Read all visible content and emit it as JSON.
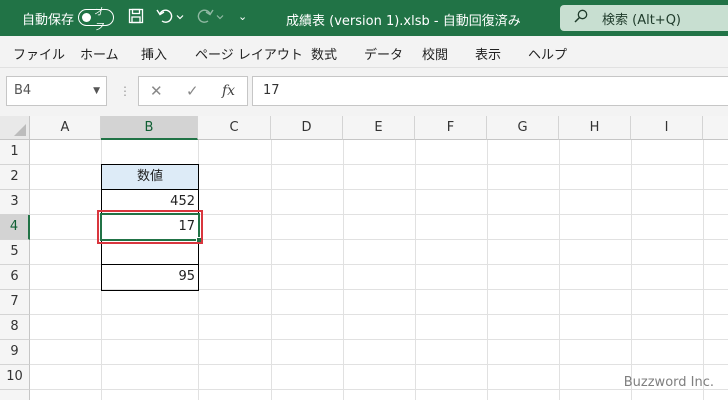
{
  "titlebar": {
    "autosave_label": "自動保存",
    "toggle_label": "オフ",
    "document_title": "成績表 (version 1).xlsb  -  自動回復済み",
    "dropdown_caret": "⌄",
    "search_label": "検索 (Alt+Q)",
    "bg_color": "#217346"
  },
  "ribbon": {
    "tabs": [
      "ファイル",
      "ホーム",
      "挿入",
      "ページ レイアウト",
      "数式",
      "データ",
      "校閲",
      "表示",
      "ヘルプ"
    ]
  },
  "formula_bar": {
    "name_box": "B4",
    "value": "17"
  },
  "grid": {
    "columns": [
      "A",
      "B",
      "C",
      "D",
      "E",
      "F",
      "G",
      "H",
      "I"
    ],
    "rows": [
      "1",
      "2",
      "3",
      "4",
      "5",
      "6",
      "7",
      "8",
      "9",
      "10"
    ],
    "selected_column": "B",
    "selected_row": "4",
    "cells": {
      "B2": "数値",
      "B3": "452",
      "B4": "17",
      "B6": "95"
    }
  },
  "watermark": "Buzzword Inc."
}
